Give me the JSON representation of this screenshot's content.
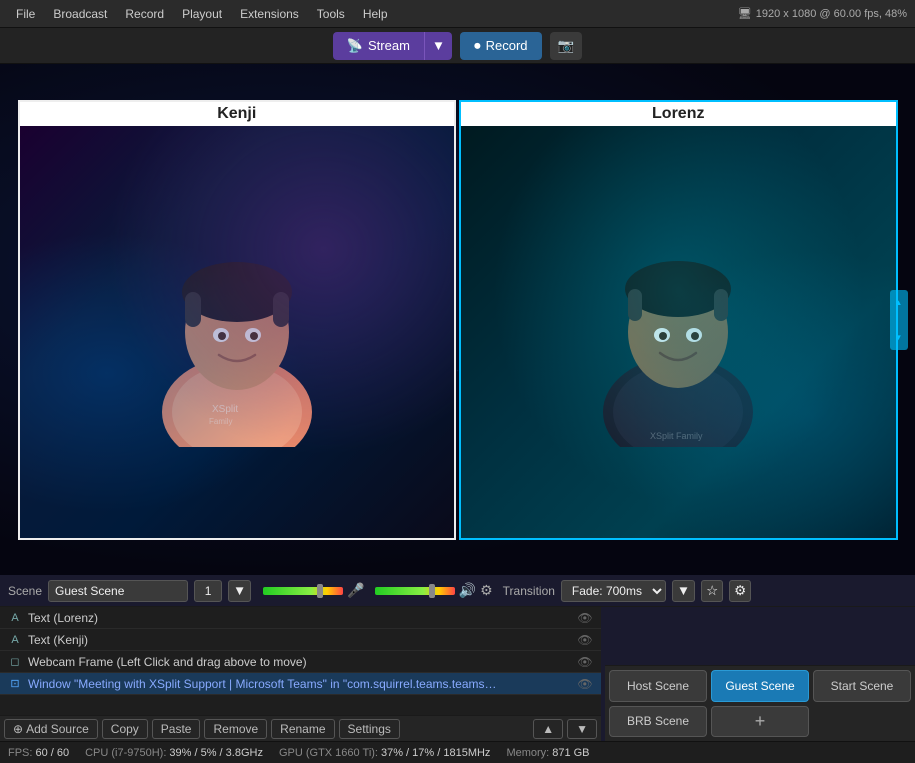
{
  "menubar": {
    "items": [
      "File",
      "Broadcast",
      "Record",
      "Playout",
      "Extensions",
      "Tools",
      "Help"
    ],
    "resolution": "1920 x 1080 @ 60.00 fps, 48%"
  },
  "toolbar": {
    "stream_label": "Stream",
    "record_label": "Record"
  },
  "preview": {
    "guest1_name": "Kenji",
    "guest2_name": "Lorenz"
  },
  "scene": {
    "label": "Scene",
    "name": "Guest Scene",
    "number": "1",
    "transition_label": "Transition",
    "transition_value": "Fade: 700ms"
  },
  "sources": [
    {
      "id": 0,
      "icon": "A",
      "name": "Text (Lorenz)",
      "visible": true,
      "selected": false
    },
    {
      "id": 1,
      "icon": "A",
      "name": "Text (Kenji)",
      "visible": true,
      "selected": false
    },
    {
      "id": 2,
      "icon": "⬜",
      "name": "Webcam Frame (Left Click and drag above to move)",
      "visible": true,
      "selected": false
    },
    {
      "id": 3,
      "icon": "▭",
      "name": "Window \"Meeting with XSplit Support | Microsoft Teams\" in \"com.squirrel.teams.teams…",
      "visible": true,
      "selected": true
    }
  ],
  "sources_toolbar": {
    "add_label": "Add Source",
    "copy_label": "Copy",
    "paste_label": "Paste",
    "remove_label": "Remove",
    "rename_label": "Rename",
    "settings_label": "Settings"
  },
  "scene_buttons": [
    {
      "id": 0,
      "label": "Host Scene",
      "active": false
    },
    {
      "id": 1,
      "label": "Guest Scene",
      "active": true
    },
    {
      "id": 2,
      "label": "Start Scene",
      "active": false
    },
    {
      "id": 3,
      "label": "BRB Scene",
      "active": false
    },
    {
      "id": 4,
      "label": "+",
      "is_plus": true
    }
  ],
  "status_bar": {
    "fps_label": "FPS:",
    "fps_value": "60 / 60",
    "cpu_label": "CPU (i7-9750H):",
    "cpu_value": "39% / 5% / 3.8GHz",
    "gpu_label": "GPU (GTX 1660 Ti):",
    "gpu_value": "37% / 17% / 1815MHz",
    "memory_label": "Memory:",
    "memory_value": "871 GB"
  },
  "icons": {
    "stream": "📡",
    "record": "⏺",
    "screenshot": "📷",
    "dropdown": "▼",
    "eye": "👁",
    "mic": "🎤",
    "speaker": "🔊",
    "settings_sliders": "⚙",
    "star": "☆",
    "window_icon": "⊡",
    "monitor_icon": "◻"
  }
}
